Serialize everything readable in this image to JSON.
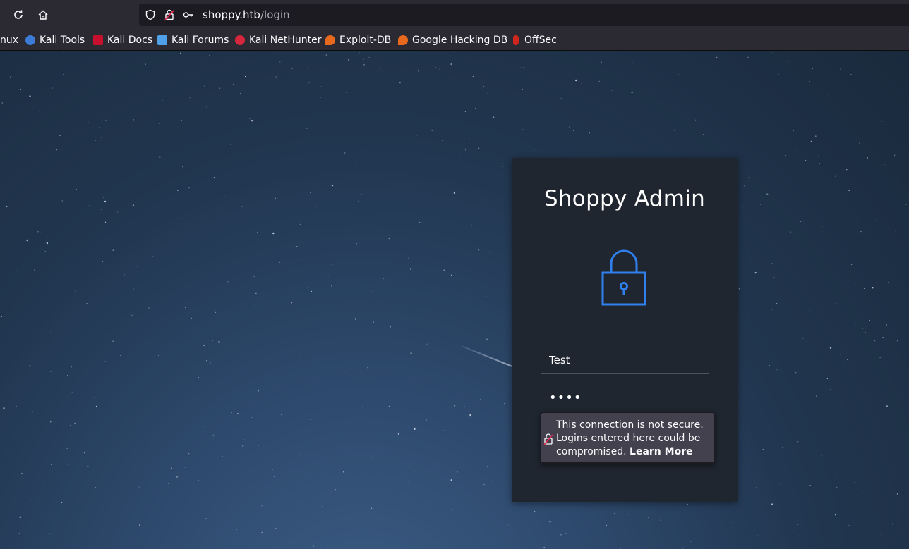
{
  "browser": {
    "url_host": "shoppy.htb",
    "url_path": "/login",
    "bookmarks": [
      {
        "label": "nux",
        "icon": "kali-linux-icon",
        "color": "#2b2a33"
      },
      {
        "label": "Kali Tools",
        "icon": "kali-tools-icon",
        "color": "#3c7bd6"
      },
      {
        "label": "Kali Docs",
        "icon": "kali-docs-icon",
        "color": "#c8102e"
      },
      {
        "label": "Kali Forums",
        "icon": "kali-forums-icon",
        "color": "#4fa0e6"
      },
      {
        "label": "Kali NetHunter",
        "icon": "kali-nethunter-icon",
        "color": "#d7263d"
      },
      {
        "label": "Exploit-DB",
        "icon": "exploit-db-icon",
        "color": "#e8691d"
      },
      {
        "label": "Google Hacking DB",
        "icon": "ghdb-icon",
        "color": "#e8691d"
      },
      {
        "label": "OffSec",
        "icon": "offsec-icon",
        "color": "#d1261e"
      }
    ]
  },
  "login": {
    "title": "Shoppy Admin",
    "username_value": "Test",
    "password_mask": "••••",
    "accent_color": "#2f80ed"
  },
  "insecure_popup": {
    "message": "This connection is not secure. Logins entered here could be compromised.",
    "link": "Learn More"
  }
}
